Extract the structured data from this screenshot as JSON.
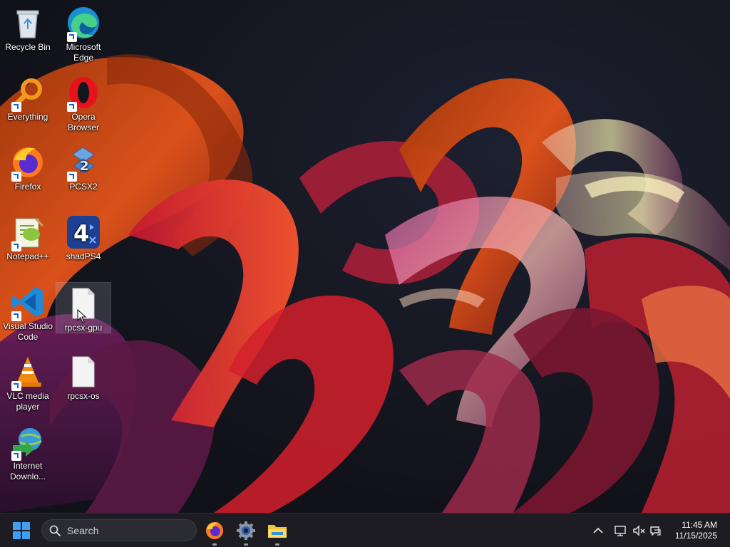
{
  "desktop": {
    "icons": [
      {
        "label": "Recycle Bin",
        "icon": "recycle-bin-icon"
      },
      {
        "label": "Microsoft Edge",
        "icon": "edge-icon"
      },
      {
        "label": "Everything",
        "icon": "everything-search-icon"
      },
      {
        "label": "Opera Browser",
        "icon": "opera-icon"
      },
      {
        "label": "Firefox",
        "icon": "firefox-icon"
      },
      {
        "label": "PCSX2",
        "icon": "pcsx2-icon"
      },
      {
        "label": "Notepad++",
        "icon": "notepadpp-icon"
      },
      {
        "label": "shadPS4",
        "icon": "shadps4-icon"
      },
      {
        "label": "Visual Studio Code",
        "icon": "vscode-icon"
      },
      {
        "label": "rpcsx-gpu",
        "icon": "file-icon"
      },
      {
        "label": "VLC media player",
        "icon": "vlc-icon"
      },
      {
        "label": "rpcsx-os",
        "icon": "file-icon"
      },
      {
        "label": "Internet Downlo...",
        "icon": "idm-icon"
      }
    ],
    "selected": "rpcsx-gpu"
  },
  "taskbar": {
    "search_placeholder": "Search",
    "pinned": [
      {
        "name": "Firefox",
        "icon": "firefox-icon",
        "running": true
      },
      {
        "name": "Settings",
        "icon": "settings-gear-icon",
        "running": true
      },
      {
        "name": "File Explorer",
        "icon": "file-explorer-icon",
        "running": true
      }
    ],
    "tray": {
      "icons": [
        "chevron-up-icon",
        "network-icon",
        "volume-muted-icon",
        "chat-icon"
      ]
    },
    "clock": {
      "time": "11:45 AM",
      "date": "11/15/2025"
    }
  },
  "colors": {
    "taskbar_bg": "#1c1c22",
    "accent": "#3ea0f4",
    "wallpaper_bg": "#111219"
  }
}
